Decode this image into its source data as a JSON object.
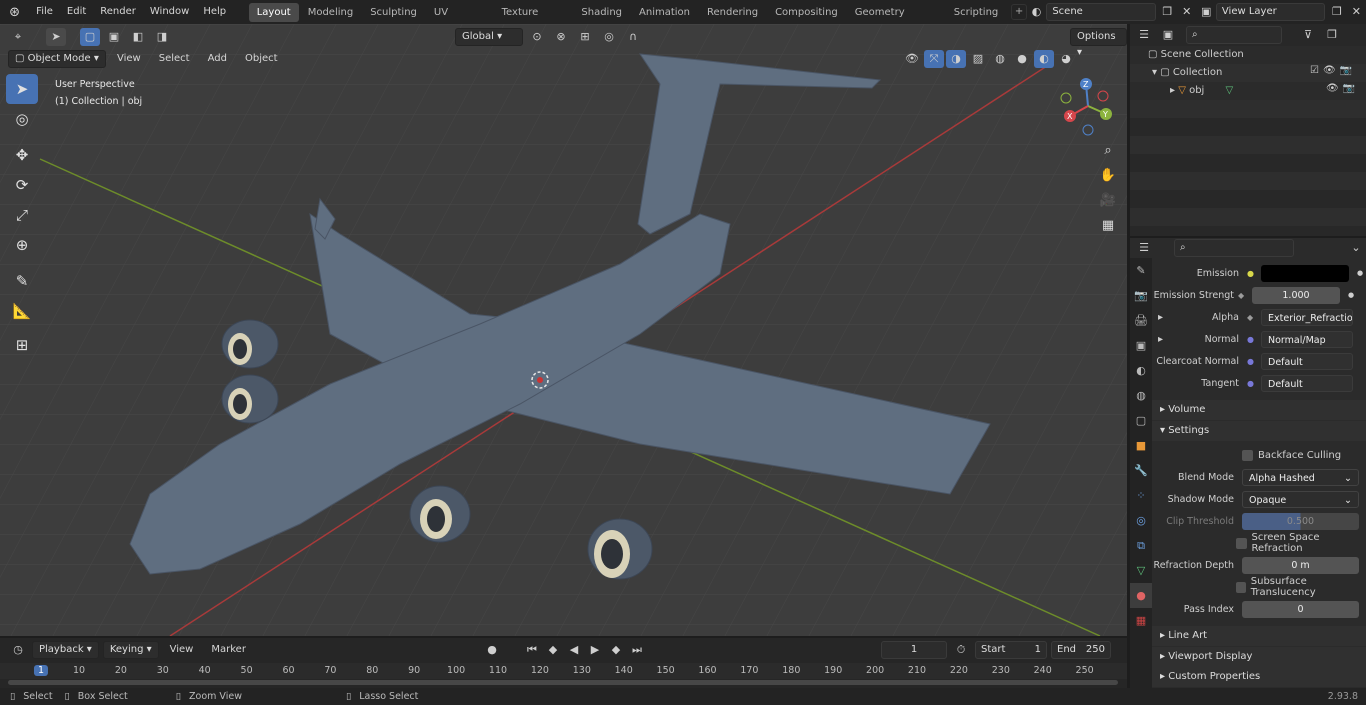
{
  "topbar": {
    "menus": [
      "File",
      "Edit",
      "Render",
      "Window",
      "Help"
    ],
    "workspaces": [
      "Layout",
      "Modeling",
      "Sculpting",
      "UV Editing",
      "Texture Paint",
      "Shading",
      "Animation",
      "Rendering",
      "Compositing",
      "Geometry Nodes",
      "Scripting"
    ],
    "active_workspace": "Layout",
    "scene": "Scene",
    "view_layer": "View Layer"
  },
  "viewport": {
    "mode": "Object Mode",
    "menus": [
      "View",
      "Select",
      "Add",
      "Object"
    ],
    "orientation": "Global",
    "options_label": "Options",
    "info_line1": "User Perspective",
    "info_line2": "(1) Collection | obj",
    "gizmo": {
      "z": "Z",
      "y": "Y",
      "x": "X"
    }
  },
  "outliner": {
    "scene_collection": "Scene Collection",
    "collection": "Collection",
    "object": "obj"
  },
  "properties": {
    "emission_label": "Emission",
    "emission_color": "#000000",
    "emission_strength_label": "Emission Strengt",
    "emission_strength_value": "1.000",
    "alpha_label": "Alpha",
    "alpha_value": "Exterior_Refraction_...",
    "normal_label": "Normal",
    "normal_value": "Normal/Map",
    "clearcoat_label": "Clearcoat Normal",
    "clearcoat_value": "Default",
    "tangent_label": "Tangent",
    "tangent_value": "Default",
    "volume_section": "Volume",
    "settings_section": "Settings",
    "backface_label": "Backface Culling",
    "blend_mode_label": "Blend Mode",
    "blend_mode_value": "Alpha Hashed",
    "shadow_mode_label": "Shadow Mode",
    "shadow_mode_value": "Opaque",
    "clip_label": "Clip Threshold",
    "clip_value": "0.500",
    "ssr_label": "Screen Space Refraction",
    "refraction_depth_label": "Refraction Depth",
    "refraction_depth_value": "0 m",
    "subsurface_label": "Subsurface Translucency",
    "pass_index_label": "Pass Index",
    "pass_index_value": "0",
    "line_art_section": "Line Art",
    "viewport_display_section": "Viewport Display",
    "custom_props_section": "Custom Properties"
  },
  "timeline": {
    "menus": [
      "Playback",
      "Keying",
      "View",
      "Marker"
    ],
    "current_frame": "1",
    "start_label": "Start",
    "start_value": "1",
    "end_label": "End",
    "end_value": "250",
    "ticks": [
      "1",
      "10",
      "20",
      "30",
      "40",
      "50",
      "60",
      "70",
      "80",
      "90",
      "100",
      "110",
      "120",
      "130",
      "140",
      "150",
      "160",
      "170",
      "180",
      "190",
      "200",
      "210",
      "220",
      "230",
      "240",
      "250"
    ]
  },
  "statusbar": {
    "select": "Select",
    "box_select": "Box Select",
    "zoom_view": "Zoom View",
    "lasso_select": "Lasso Select",
    "version": "2.93.8"
  }
}
